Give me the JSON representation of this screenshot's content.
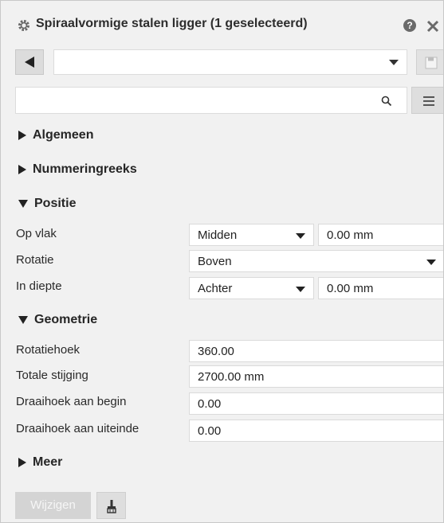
{
  "window": {
    "title": "Spiraalvormige stalen ligger (1 geselecteerd)",
    "help_glyph": "?"
  },
  "toolbar": {
    "preset_value": "",
    "search_value": "",
    "search_placeholder": ""
  },
  "sections": {
    "algemeen": "Algemeen",
    "nummeringreeks": "Nummeringreeks",
    "positie": "Positie",
    "geometrie": "Geometrie",
    "meer": "Meer"
  },
  "positie": {
    "op_vlak": {
      "label": "Op vlak",
      "option": "Midden",
      "value": "0.00 mm"
    },
    "rotatie": {
      "label": "Rotatie",
      "option": "Boven"
    },
    "in_diepte": {
      "label": "In diepte",
      "option": "Achter",
      "value": "0.00 mm"
    }
  },
  "geometrie": {
    "rotatiehoek": {
      "label": "Rotatiehoek",
      "value": "360.00"
    },
    "totale_stijging": {
      "label": "Totale stijging",
      "value": "2700.00 mm"
    },
    "draaihoek_begin": {
      "label": "Draaihoek aan begin",
      "value": "0.00"
    },
    "draaihoek_einde": {
      "label": "Draaihoek aan uiteinde",
      "value": "0.00"
    }
  },
  "footer": {
    "apply_label": "Wijzigen"
  },
  "icons": {
    "gear": "gear-icon",
    "help": "help-icon",
    "close": "close-icon",
    "back": "back-arrow-icon",
    "save": "save-icon",
    "search": "search-icon",
    "menu": "menu-icon",
    "brush": "brush-icon"
  },
  "colors": {
    "panel_bg": "#f1f1f1",
    "field_bg": "#ffffff",
    "disabled_button": "#d4d4d4"
  }
}
